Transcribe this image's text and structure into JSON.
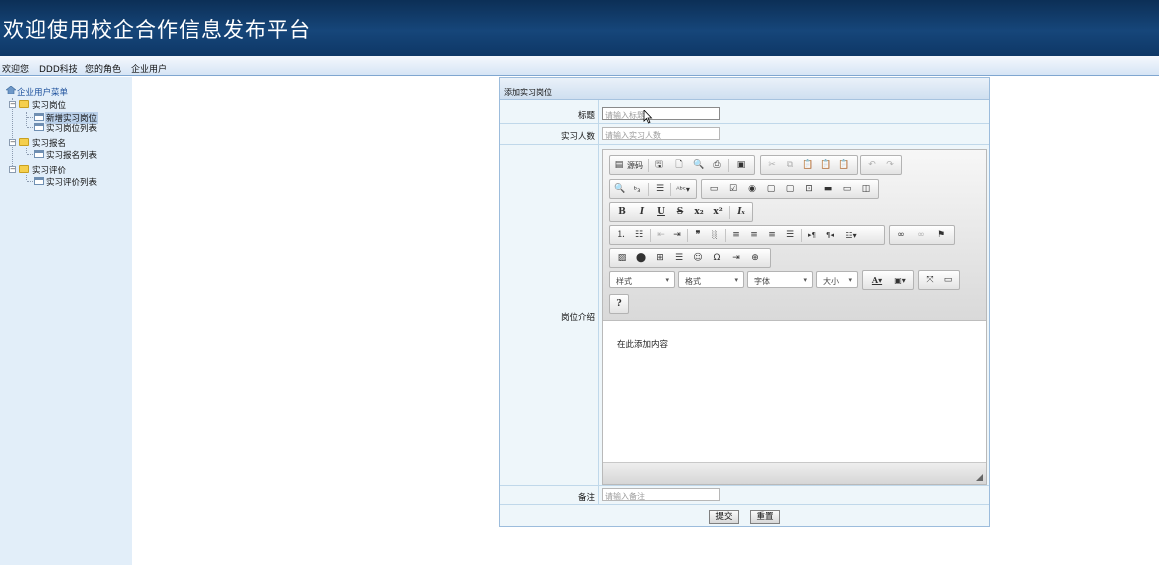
{
  "header": {
    "title": "欢迎使用校企合作信息发布平台"
  },
  "welcome_bar": {
    "welcome": "欢迎您",
    "user": "DDD科技",
    "role_label": "您的角色",
    "role": "企业用户"
  },
  "sidebar": {
    "root": "企业用户菜单",
    "groups": [
      {
        "label": "实习岗位",
        "items": [
          {
            "label": "新增实习岗位",
            "selected": true
          },
          {
            "label": "实习岗位列表"
          }
        ]
      },
      {
        "label": "实习报名",
        "items": [
          {
            "label": "实习报名列表"
          }
        ]
      },
      {
        "label": "实习评价",
        "items": [
          {
            "label": "实习评价列表"
          }
        ]
      }
    ]
  },
  "form": {
    "panel_title": "添加实习岗位",
    "fields": {
      "title": {
        "label": "标题",
        "placeholder": "请输入标题"
      },
      "headcount": {
        "label": "实习人数",
        "placeholder": "请输入实习人数"
      },
      "intro": {
        "label": "岗位介绍"
      },
      "remark": {
        "label": "备注",
        "placeholder": "请输入备注"
      }
    },
    "editor": {
      "source_label": "源码",
      "combos": {
        "style": "样式",
        "format": "格式",
        "font": "字体",
        "size": "大小"
      },
      "help": "?",
      "content": "在此添加内容"
    },
    "buttons": {
      "submit": "提交",
      "reset": "重置"
    }
  }
}
